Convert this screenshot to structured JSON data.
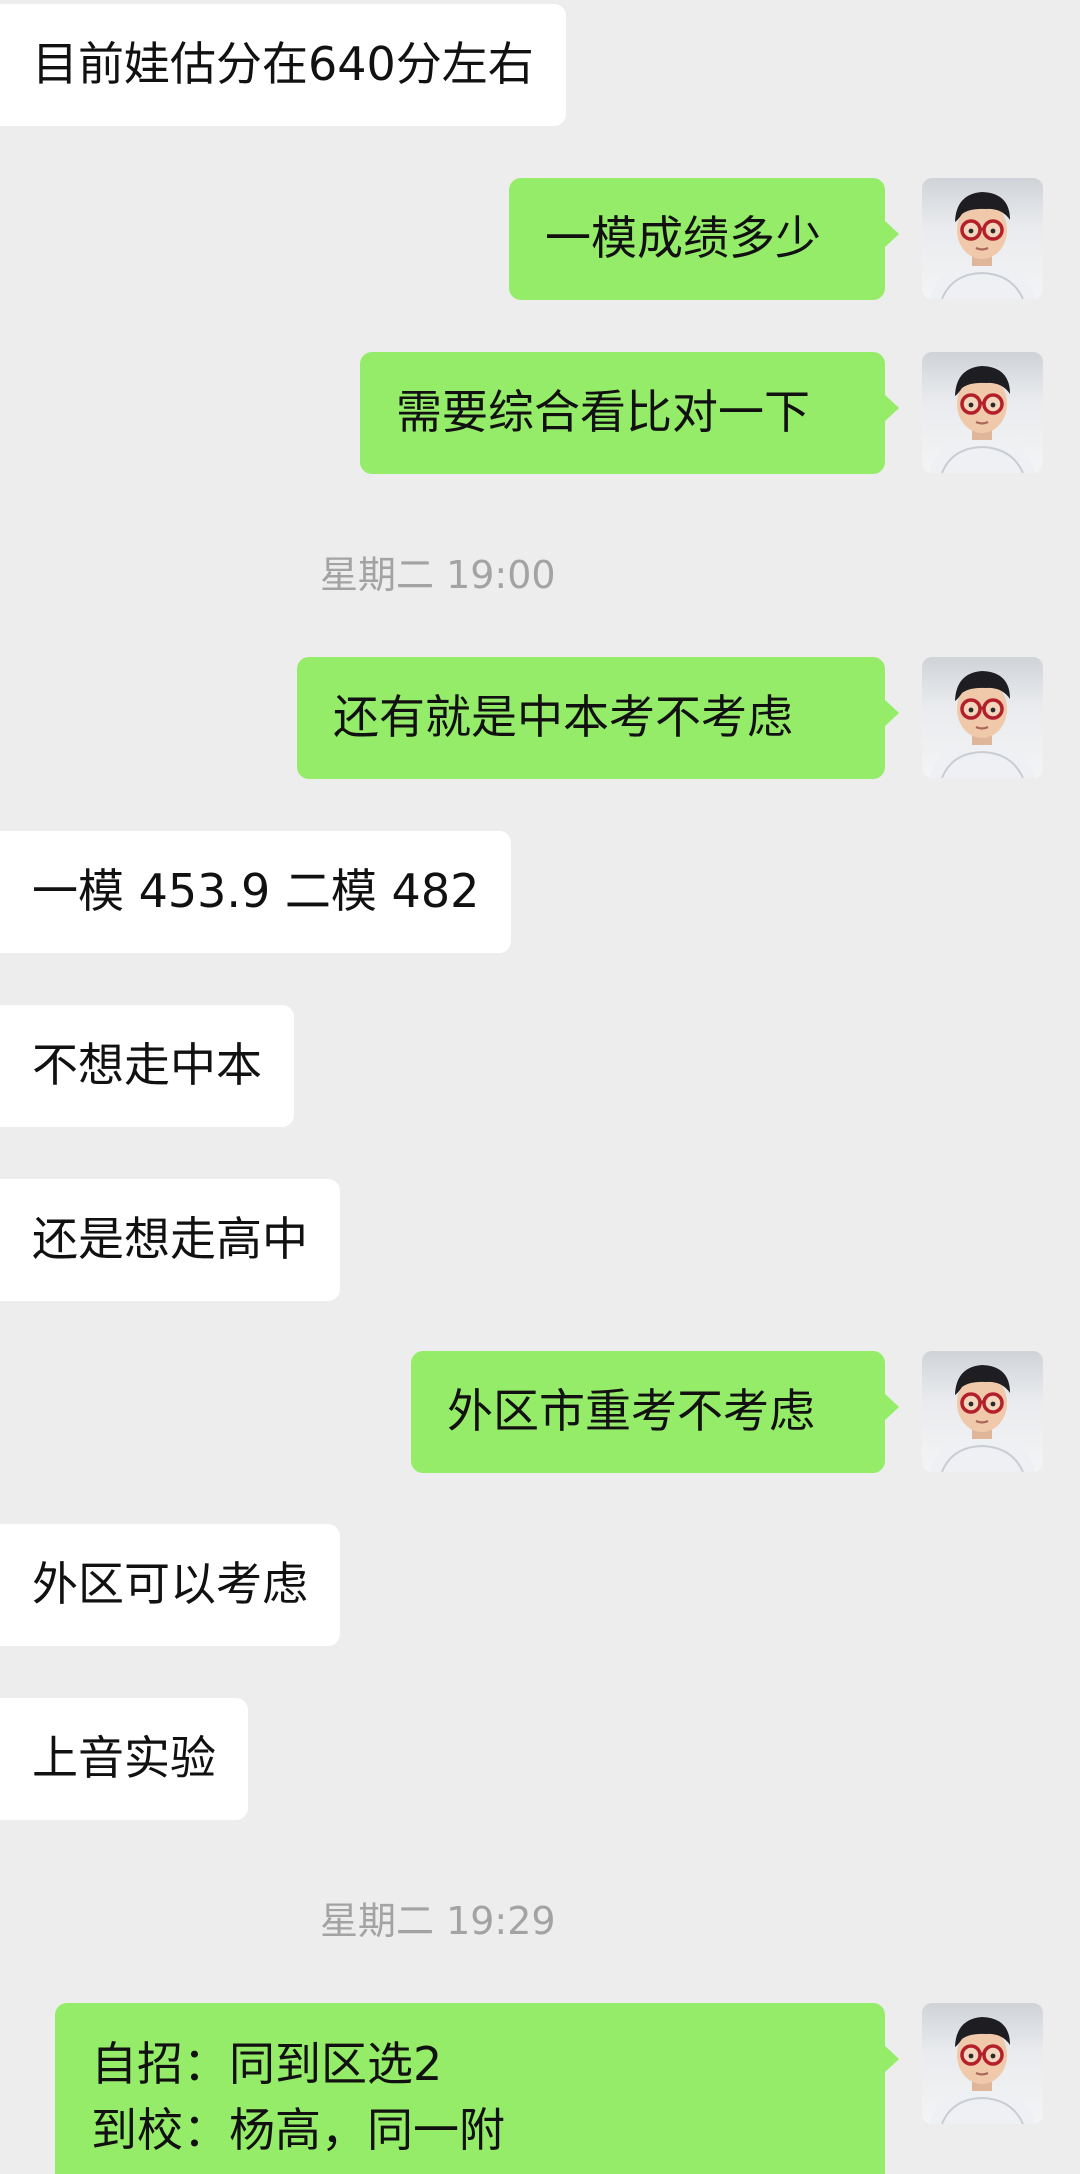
{
  "messages": [
    {
      "side": "in",
      "text": "目前娃估分在640分左右"
    },
    {
      "side": "out",
      "text": "一模成绩多少"
    },
    {
      "side": "out",
      "text": "需要综合看比对一下"
    },
    {
      "side": "time",
      "text": "星期二 19:00"
    },
    {
      "side": "out",
      "text": "还有就是中本考不考虑"
    },
    {
      "side": "in",
      "text": "一模 453.9 二模 482"
    },
    {
      "side": "in",
      "text": "不想走中本"
    },
    {
      "side": "in",
      "text": "还是想走高中"
    },
    {
      "side": "out",
      "text": "外区市重考不考虑"
    },
    {
      "side": "in",
      "text": "外区可以考虑"
    },
    {
      "side": "in",
      "text": "上音实验"
    },
    {
      "side": "time",
      "text": "星期二 19:29"
    },
    {
      "side": "out",
      "lines": [
        "自招：同到区选2",
        "到校：杨高，同一附"
      ]
    }
  ],
  "avatar": {
    "icon": "user-avatar-icon"
  },
  "colors": {
    "background": "#ededed",
    "incoming_bubble": "#ffffff",
    "outgoing_bubble": "#95ec69",
    "timestamp_text": "#a3a3a3"
  }
}
